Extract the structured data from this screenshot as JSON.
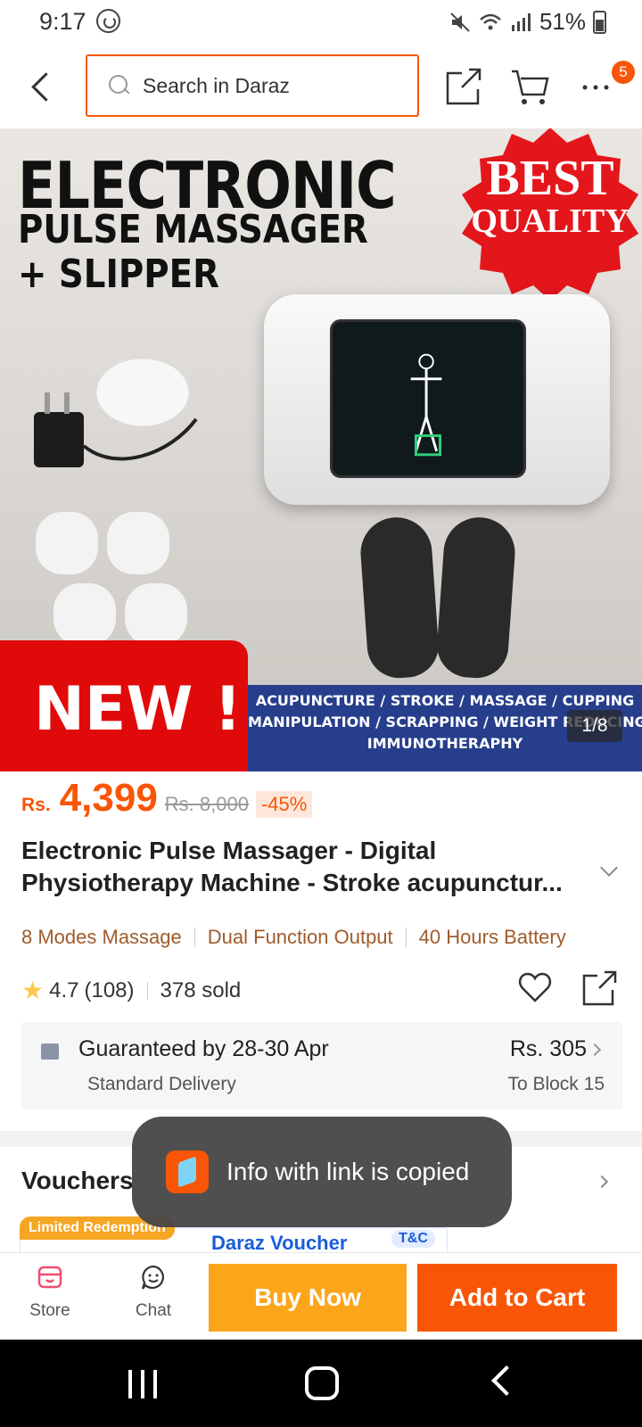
{
  "status_bar": {
    "time": "9:17",
    "battery": "51%",
    "icons": [
      "whatsapp-icon",
      "mute-icon",
      "wifi-icon",
      "signal-icon",
      "battery-icon"
    ]
  },
  "header": {
    "search_placeholder": "Search in Daraz",
    "cart_badge": "5",
    "icons": [
      "back-icon",
      "search-icon",
      "share-icon",
      "cart-icon",
      "more-icon"
    ]
  },
  "gallery": {
    "headline1": "ELECTRONIC",
    "headline2": "PULSE MASSAGER",
    "headline3": "+ SLIPPER",
    "seal_line1": "BEST",
    "seal_line2": "QUALITY",
    "new_label": "NEW !",
    "band_line1": "ACUPUNCTURE / STROKE / MASSAGE / CUPPING",
    "band_line2": "MANIPULATION / SCRAPPING / WEIGHT REDUCING",
    "band_line3": "IMMUNOTHERAPHY",
    "counter": "1/8"
  },
  "product": {
    "currency": "Rs.",
    "price": "4,399",
    "old_price": "Rs. 8,000",
    "discount": "-45%",
    "title": "Electronic Pulse Massager - Digital Physiotherapy Machine - Stroke acupunctur...",
    "features": [
      "8 Modes Massage",
      "Dual Function Output",
      "40 Hours Battery"
    ],
    "rating": "4.7",
    "reviews": "(108)",
    "sold": "378 sold"
  },
  "delivery": {
    "guarantee": "Guaranteed by 28-30 Apr",
    "method": "Standard Delivery",
    "fee": "Rs. 305",
    "destination": "To Block 15"
  },
  "vouchers": {
    "heading": "Vouchers",
    "limited_tag": "Limited Redemption",
    "card_title": "Daraz Voucher",
    "tc_label": "T&C"
  },
  "toast": {
    "message": "Info with link is copied"
  },
  "bottom_bar": {
    "store_label": "Store",
    "chat_label": "Chat",
    "buy_now": "Buy Now",
    "add_to_cart": "Add to Cart"
  },
  "colors": {
    "brand": "#f85606",
    "buy_now": "#fba61a",
    "voucher_blue": "#1a5dd9"
  }
}
